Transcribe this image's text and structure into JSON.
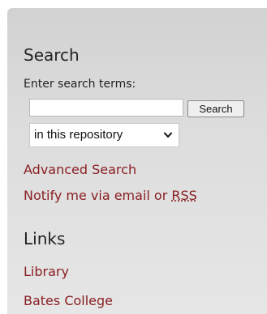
{
  "search": {
    "heading": "Search",
    "label": "Enter search terms:",
    "input_value": "",
    "button_label": "Search",
    "scope_selected": "in this repository",
    "advanced_link": "Advanced Search",
    "notify_text": "Notify me via email or ",
    "rss_text": "RSS"
  },
  "links": {
    "heading": "Links",
    "items": [
      {
        "label": "Library"
      },
      {
        "label": "Bates College"
      }
    ]
  },
  "colors": {
    "link": "#8a1f23",
    "panel_top": "#d2d2d2",
    "panel_bottom": "#e6e6e6"
  },
  "icons": {
    "scope_dropdown": "chevron-down-icon"
  }
}
